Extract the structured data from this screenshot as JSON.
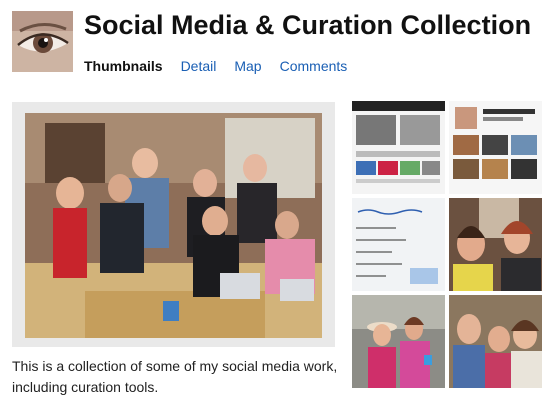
{
  "header": {
    "title": "Social Media & Curation Collection"
  },
  "tabs": [
    {
      "label": "Thumbnails",
      "active": true
    },
    {
      "label": "Detail",
      "active": false
    },
    {
      "label": "Map",
      "active": false
    },
    {
      "label": "Comments",
      "active": false
    }
  ],
  "main": {
    "description": "This is a collection of some of my social media work, including curation tools."
  },
  "thumbnails": [
    {
      "subject": "website screenshot"
    },
    {
      "subject": "website screenshot"
    },
    {
      "subject": "whiteboard notes"
    },
    {
      "subject": "people photo"
    },
    {
      "subject": "people photo"
    },
    {
      "subject": "people photo"
    }
  ],
  "colors": {
    "link": "#1a5fb4",
    "frame": "#e9e9e9"
  }
}
